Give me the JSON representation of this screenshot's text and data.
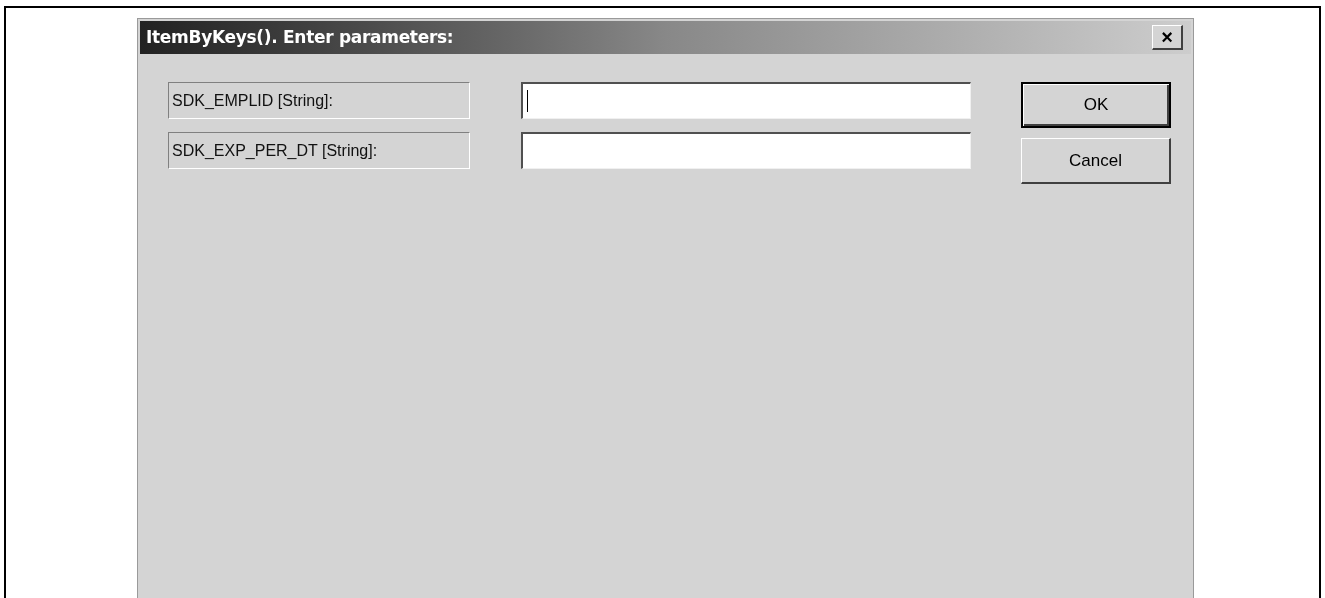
{
  "window": {
    "title": "ItemByKeys(). Enter parameters:",
    "close_label": "×"
  },
  "parameters": [
    {
      "label": "SDK_EMPLID [String]:",
      "focused": true
    },
    {
      "label": "SDK_EXP_PER_DT [String]:",
      "focused": false
    }
  ],
  "buttons": [
    {
      "label": "OK",
      "default": true
    },
    {
      "label": "Cancel",
      "default": false
    }
  ]
}
